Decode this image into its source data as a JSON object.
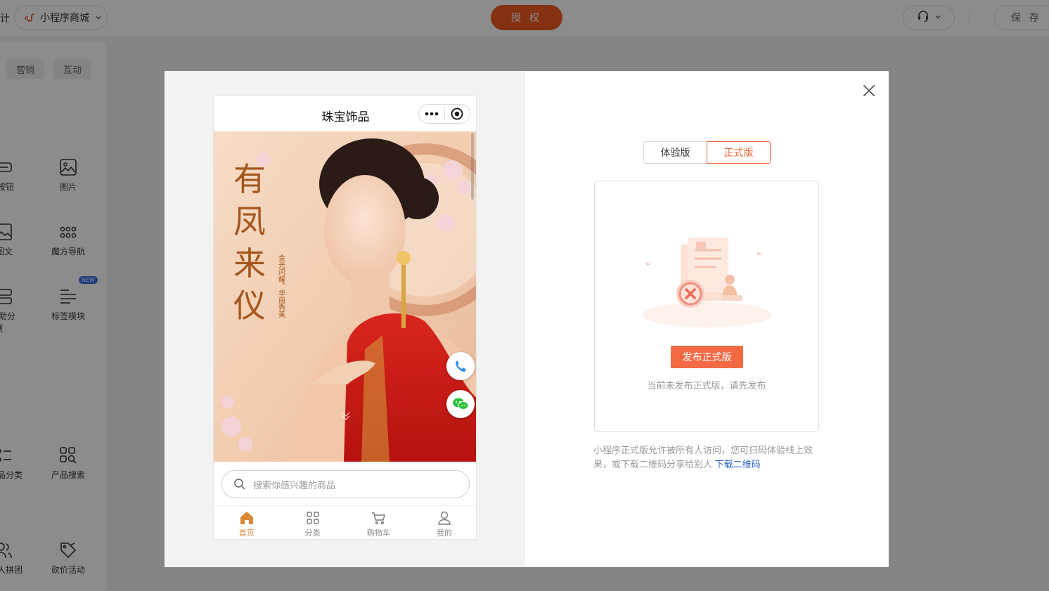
{
  "topbar": {
    "design_tab": "计",
    "app_name": "小程序商城",
    "auth_label": "授 权",
    "save_label": "保 存"
  },
  "sidebar": {
    "tabs": [
      "营销",
      "互动"
    ],
    "components": [
      {
        "label": "按钮",
        "icon": "button-icon"
      },
      {
        "label": "图片",
        "icon": "image-icon"
      },
      {
        "label": "图文",
        "icon": "image-text-icon"
      },
      {
        "label": "魔方导航",
        "icon": "cube-nav-icon"
      },
      {
        "label": "辅助分割",
        "icon": "divider-icon"
      },
      {
        "label": "标签模块",
        "icon": "tag-module-icon"
      },
      {
        "label": "产品分类",
        "icon": "product-category-icon"
      },
      {
        "label": "产品搜索",
        "icon": "product-search-icon"
      },
      {
        "label": "多人拼团",
        "icon": "group-buy-icon"
      },
      {
        "label": "砍价活动",
        "icon": "bargain-icon"
      }
    ],
    "new_badge": "NEW"
  },
  "phone": {
    "title": "珠宝饰品",
    "banner": {
      "headline_chars": [
        "有",
        "凤",
        "来",
        "仪"
      ],
      "subline": "金光闪耀，华丽秀美"
    },
    "search_placeholder": "搜索你感兴趣的商品",
    "tabs": [
      {
        "label": "首页",
        "icon": "home-icon",
        "active": true
      },
      {
        "label": "分类",
        "icon": "grid-icon",
        "active": false
      },
      {
        "label": "购物车",
        "icon": "cart-icon",
        "active": false
      },
      {
        "label": "我的",
        "icon": "user-icon",
        "active": false
      }
    ]
  },
  "publish": {
    "segment": [
      "体验版",
      "正式版"
    ],
    "active_segment": "正式版",
    "publish_button": "发布正式版",
    "empty_tip": "当前未发布正式版，请先发布",
    "description": "小程序正式版允许被所有人访问，您可扫码体验线上效果，或下载二维码分享给别人",
    "download_link": "下载二维码"
  },
  "colors": {
    "accent": "#f05a22",
    "publish_button": "#f26a44",
    "link": "#2a62c9",
    "tab_active": "#d98a38"
  }
}
